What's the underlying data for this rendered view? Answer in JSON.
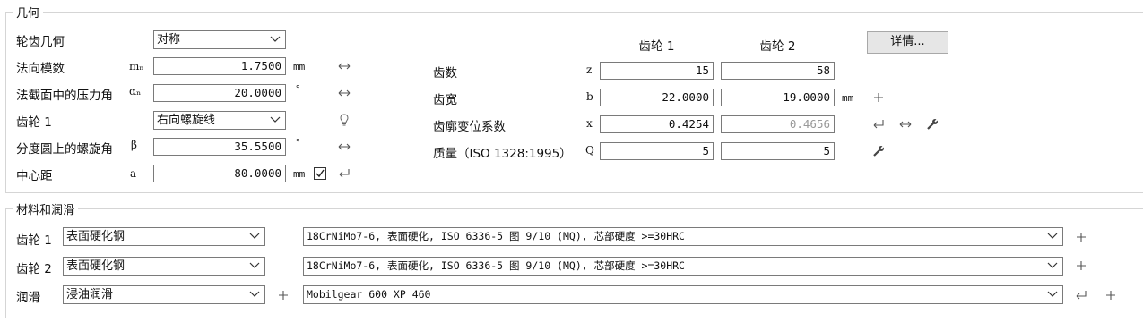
{
  "geometry": {
    "title": "几何",
    "rows": [
      {
        "label": "轮齿几何",
        "value": "对称"
      },
      {
        "label": "法向模数",
        "symbol": "mₙ",
        "value": "1.7500",
        "unit": "mm"
      },
      {
        "label": "法截面中的压力角",
        "symbol": "αₙ",
        "value": "20.0000",
        "unit": "°"
      },
      {
        "label": "齿轮 1",
        "value": "右向螺旋线"
      },
      {
        "label": "分度圆上的螺旋角",
        "symbol": "β",
        "value": "35.5500",
        "unit": "°"
      },
      {
        "label": "中心距",
        "symbol": "a",
        "value": "80.0000",
        "unit": "mm"
      }
    ],
    "col_headers": [
      "齿轮 1",
      "齿轮 2"
    ],
    "details_button": "详情...",
    "gear_rows": [
      {
        "label": "齿数",
        "symbol": "z",
        "g1": "15",
        "g2": "58",
        "unit": ""
      },
      {
        "label": "齿宽",
        "symbol": "b",
        "g1": "22.0000",
        "g2": "19.0000",
        "unit": "mm"
      },
      {
        "label": "齿廓变位系数",
        "symbol": "x",
        "g1": "0.4254",
        "g2": "0.4656",
        "unit": ""
      },
      {
        "label": "质量（ISO 1328:1995）",
        "symbol": "Q",
        "g1": "5",
        "g2": "5",
        "unit": ""
      }
    ]
  },
  "materials": {
    "title": "材料和润滑",
    "rows": [
      {
        "label": "齿轮 1",
        "type": "表面硬化钢",
        "spec": "18CrNiMo7-6, 表面硬化, ISO 6336-5 图 9/10 (MQ), 芯部硬度 >=30HRC"
      },
      {
        "label": "齿轮 2",
        "type": "表面硬化钢",
        "spec": "18CrNiMo7-6, 表面硬化, ISO 6336-5 图 9/10 (MQ), 芯部硬度 >=30HRC"
      },
      {
        "label": "润滑",
        "type": "浸油润滑",
        "spec": "Mobilgear 600 XP 460"
      }
    ]
  },
  "icons": {
    "dropdown": "chevron-down-icon",
    "double_arrow": "double-arrow-icon",
    "return": "return-arrow-icon",
    "plus": "plus-icon",
    "bulb": "lightbulb-icon",
    "wrench": "wrench-icon",
    "checkbox": "checkbox-checked"
  },
  "colors": {
    "border": "#7a7a7a",
    "group_border": "#d5d5d5",
    "muted_text": "#9a9a9a",
    "button_bg": "#e6e6e6"
  }
}
